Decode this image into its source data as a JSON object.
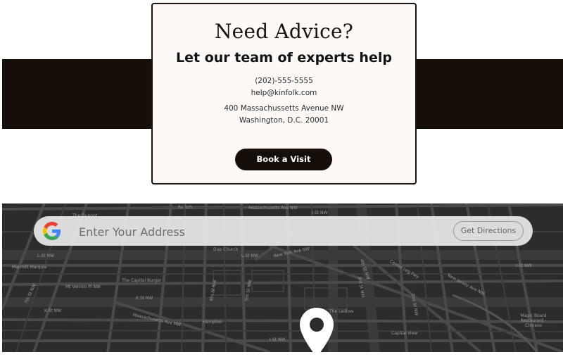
{
  "contact": {
    "heading": "Need Advice?",
    "subheading": "Let our team of experts help",
    "phone": "(202)-555-5555",
    "email": "help@kinfolk.com",
    "address_line1": "400 Massachussetts Avenue NW",
    "address_line2": "Washington, D.C. 20001",
    "button_label": "Book a Visit"
  },
  "map": {
    "search_placeholder": "Enter Your Address",
    "directions_label": "Get Directions",
    "search_icon": "google-logo",
    "pin_icon": "map-pin-icon",
    "labels": [
      "The Dupont",
      "Rs Sch",
      "I-St NW",
      "Massachusetts Ave NW",
      "L-St NW",
      "Dup Church",
      "L-St NW",
      "New York Ave NW",
      "Marriott Marquis",
      "Mt Vernon Pl NW",
      "The Capital Burger",
      "K St NW",
      "K-St NW",
      "Massachusetts Ave NW",
      "Hampton",
      "Center Leg Fwy",
      "New Jersey Ave NW",
      "The Ledlow",
      "Capital View",
      "Magic Board Restaurant - Chinese",
      "I-St NW",
      "2nd St NW",
      "6th St NW",
      "5th St NW",
      "3rd St NW",
      "4th St NW",
      "7th St NW",
      "I-St NW"
    ]
  },
  "colors": {
    "band": "#160e08",
    "card_bg": "#fdf9f6",
    "map_bg": "#2c2c2c",
    "button_bg": "#160e08"
  }
}
